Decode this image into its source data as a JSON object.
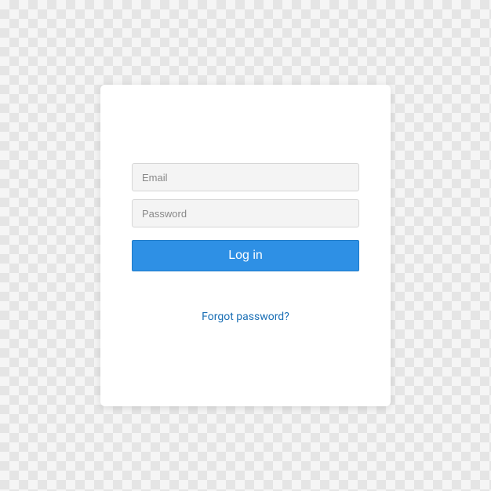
{
  "form": {
    "email_placeholder": "Email",
    "password_placeholder": "Password",
    "login_button_label": "Log in",
    "forgot_password_label": "Forgot password?"
  }
}
